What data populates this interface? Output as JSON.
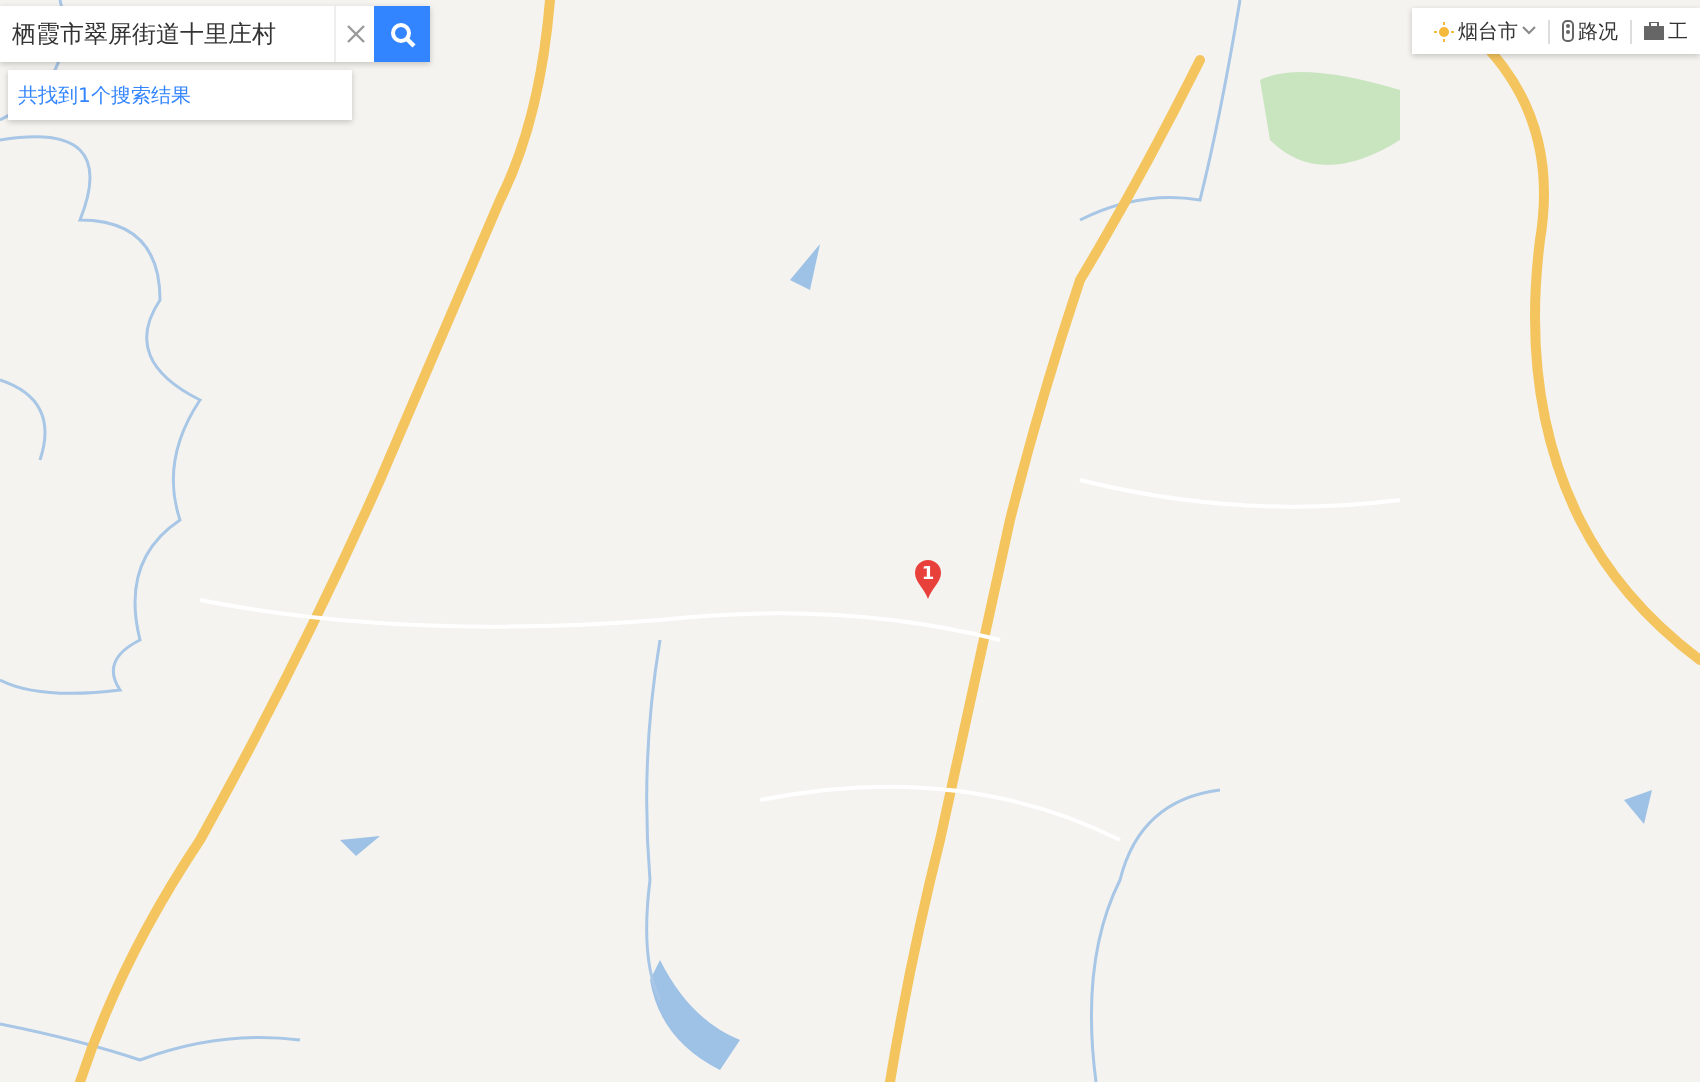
{
  "search": {
    "value": "栖霞市翠屏街道十里庄村"
  },
  "result_summary": "共找到1个搜索结果",
  "city_selector": {
    "label": "烟台市"
  },
  "toolbar": [
    {
      "kind": "traffic",
      "label": "路况"
    },
    {
      "kind": "tools",
      "label": "工"
    }
  ],
  "marker": {
    "label": "1"
  }
}
